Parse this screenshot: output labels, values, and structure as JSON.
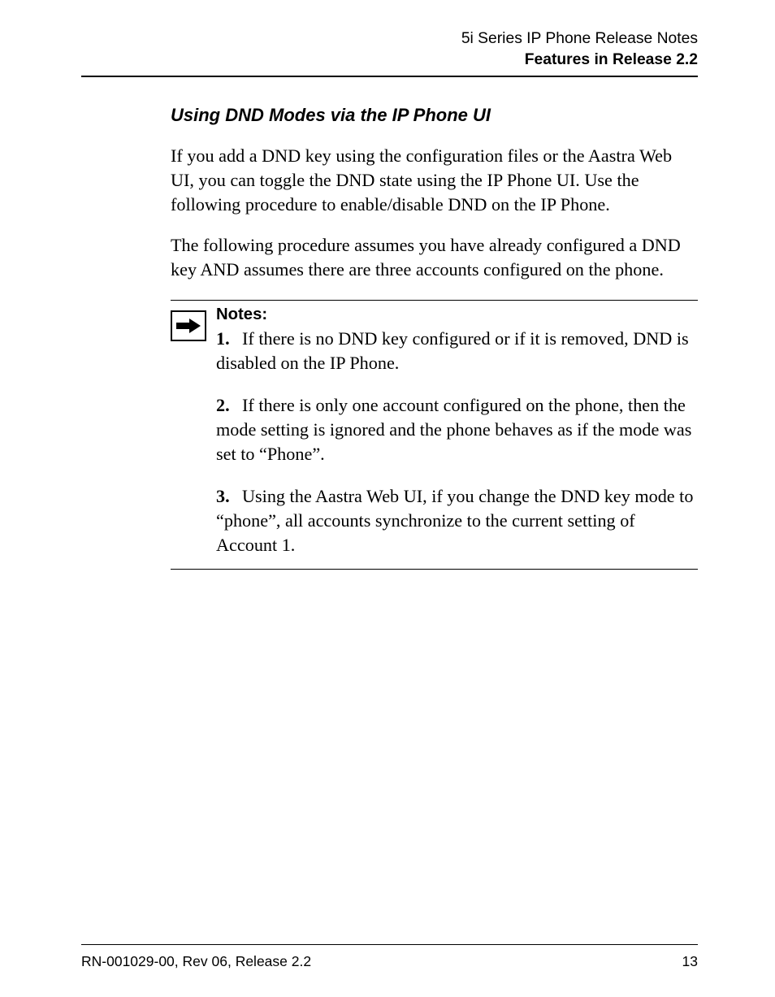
{
  "header": {
    "line1": "5i Series IP Phone Release Notes",
    "line2": "Features in Release 2.2"
  },
  "section": {
    "title": "Using DND Modes via the IP Phone UI",
    "para1": "If you add a DND key using the configuration files or the Aastra Web UI, you can toggle the DND state using the IP Phone UI. Use the following procedure to enable/disable DND on the IP Phone.",
    "para2": "The following procedure assumes you have already configured a DND key AND assumes there are three accounts configured on the phone."
  },
  "notes": {
    "label": "Notes:",
    "items": [
      {
        "num": "1.",
        "text": "If there is no DND key configured or if it is removed, DND is disabled on the IP Phone."
      },
      {
        "num": "2.",
        "text": "If there is only one account configured on the phone, then the mode setting is ignored and the phone behaves as if the mode was set to “Phone”."
      },
      {
        "num": "3.",
        "text": "Using the Aastra Web UI, if you change the DND key mode to “phone”, all accounts synchronize to the current setting of Account 1."
      }
    ]
  },
  "footer": {
    "left": "RN-001029-00, Rev 06, Release 2.2",
    "right": "13"
  }
}
